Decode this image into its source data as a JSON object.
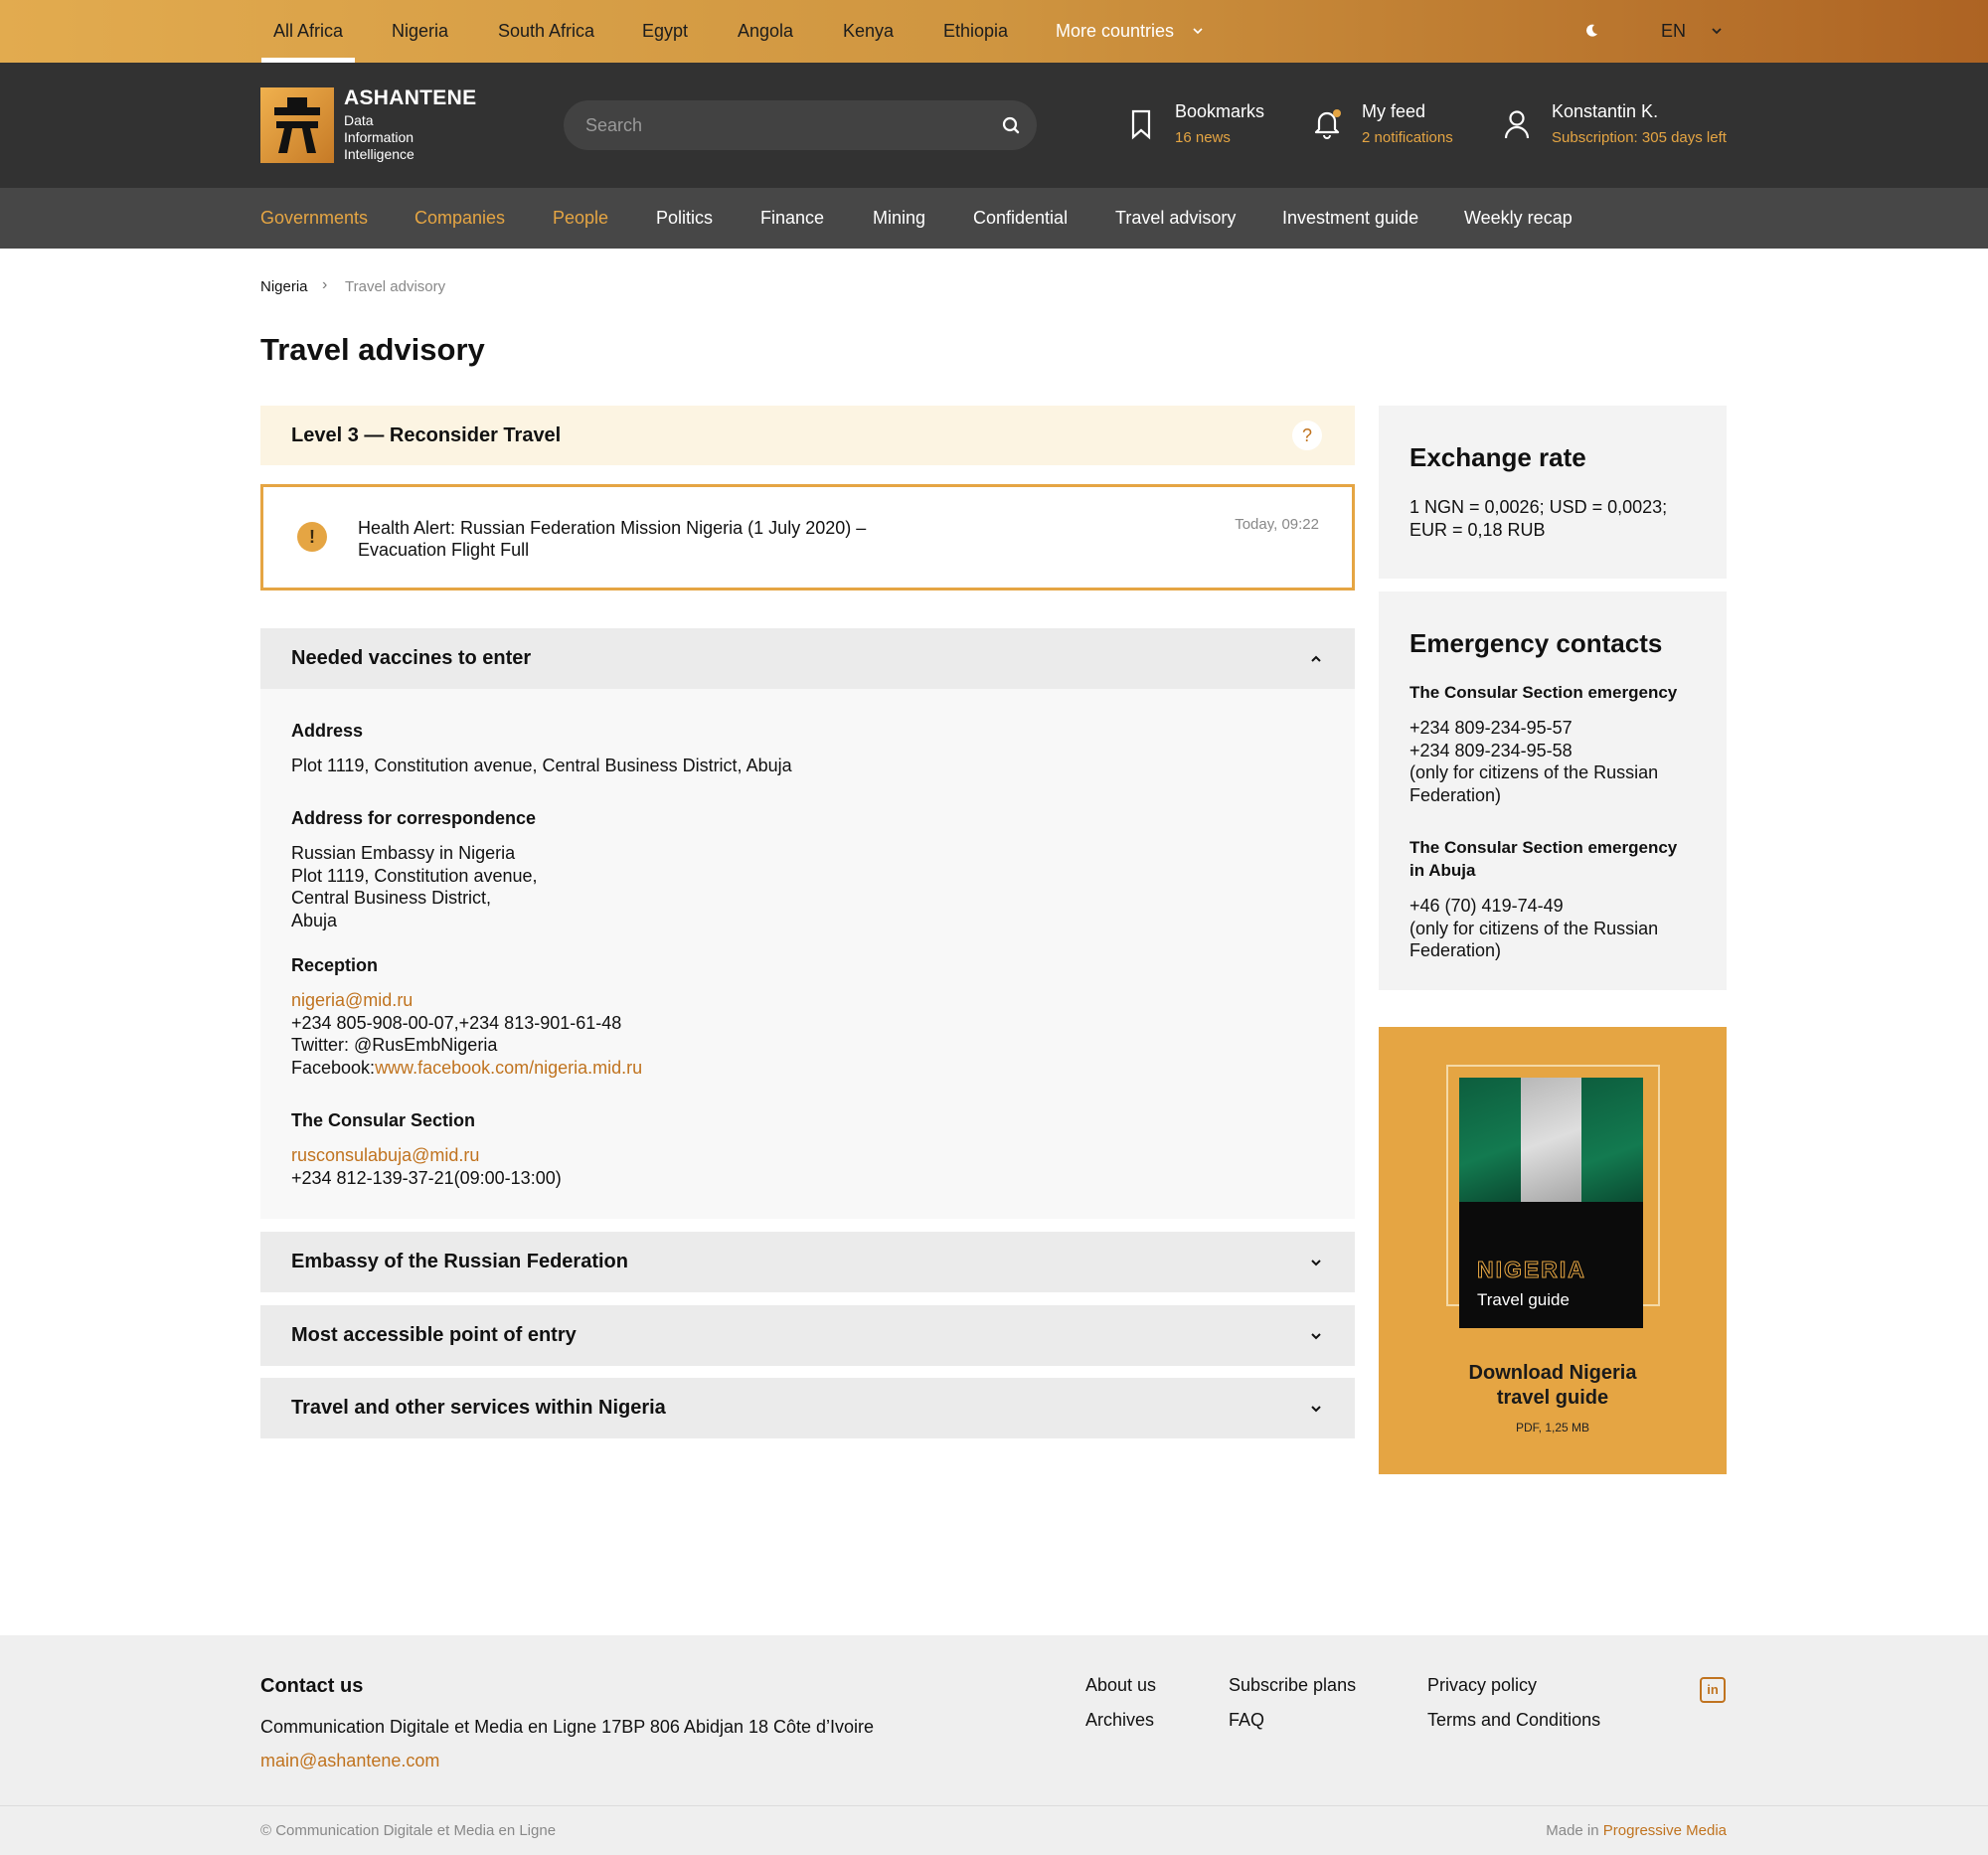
{
  "countries": {
    "items": [
      "All Africa",
      "Nigeria",
      "South Africa",
      "Egypt",
      "Angola",
      "Kenya",
      "Ethiopia"
    ],
    "more_label": "More countries",
    "language": "EN"
  },
  "header": {
    "brand_name": "ASHANTENE",
    "brand_tagline": [
      "Data",
      "Information",
      "Intelligence"
    ],
    "search_placeholder": "Search",
    "bookmarks": {
      "title": "Bookmarks",
      "sub": "16 news"
    },
    "feed": {
      "title": "My feed",
      "sub": "2 notifications"
    },
    "user": {
      "title": "Konstantin K.",
      "sub": "Subscription: 305 days left"
    }
  },
  "nav": {
    "items": [
      "Governments",
      "Companies",
      "People",
      "Politics",
      "Finance",
      "Mining",
      "Confidential",
      "Travel advisory",
      "Investment guide",
      "Weekly recap"
    ]
  },
  "breadcrumb": {
    "parent": "Nigeria",
    "current": "Travel advisory"
  },
  "page_title": "Travel advisory",
  "level": {
    "label": "Level 3 — Reconsider Travel",
    "help": "?"
  },
  "alert": {
    "icon": "!",
    "line1": "Health Alert: Russian Federation Mission Nigeria (1 July 2020) –",
    "line2": "Evacuation Flight Full",
    "time": "Today, 09:22"
  },
  "accordions": {
    "open_title": "Needed vaccines to enter",
    "embassy_title": "Embassy of the Russian Federation",
    "entry_title": "Most accessible point of entry",
    "services_title": "Travel and other services within Nigeria"
  },
  "details": {
    "address_label": "Address",
    "address": "Plot 1119, Constitution avenue, Central Business District, Abuja",
    "corr_label": "Address for correspondence",
    "corr_lines": [
      "Russian Embassy in Nigeria",
      "Plot 1119, Constitution avenue,",
      "Central Business District,",
      "Abuja"
    ],
    "reception_label": "Reception",
    "reception_email": "nigeria@mid.ru",
    "reception_phones": "+234 805-908-00-07,+234 813-901-61-48",
    "reception_twitter": "Twitter: @RusEmbNigeria",
    "reception_facebook_label": "Facebook:",
    "reception_facebook_url": "www.facebook.com/nigeria.mid.ru",
    "consular_label": "The Consular Section",
    "consular_email": "rusconsulabuja@mid.ru",
    "consular_phone": "+234 812-139-37-21(09:00-13:00)"
  },
  "exchange": {
    "title": "Exchange rate",
    "line1": "1 NGN = 0,0026; USD = 0,0023;",
    "line2": "EUR = 0,18 RUB"
  },
  "emergency": {
    "title": "Emergency contacts",
    "c1_title": "The Consular Section emergency",
    "c1_lines": [
      "+234 809-234-95-57",
      "+234 809-234-95-58",
      "(only for citizens of the Russian",
      "Federation)"
    ],
    "c2_title_lines": [
      "The Consular Section emergency",
      "in Abuja"
    ],
    "c2_lines": [
      "+46 (70) 419-74-49",
      "(only for citizens of the Russian",
      "Federation)"
    ]
  },
  "guide": {
    "cover_title": "NIGERIA",
    "cover_sub": "Travel guide",
    "download_lines": [
      "Download Nigeria",
      "travel guide"
    ],
    "meta": "PDF, 1,25 MB",
    "flag_colors": [
      "#0f6b47",
      "#c9c9c9",
      "#0f6b47"
    ]
  },
  "footer": {
    "contact_title": "Contact us",
    "address": "Communication Digitale et Media en Ligne 17BP 806 Abidjan 18 Côte d’Ivoire",
    "email": "main@ashantene.com",
    "links": [
      "About us",
      "Archives",
      "Subscribe plans",
      "FAQ",
      "Privacy policy",
      "Terms and Conditions"
    ],
    "social": "in",
    "copyright": "© Communication Digitale et Media en Ligne",
    "made_prefix": "Made in",
    "made_by": "Progressive Media"
  },
  "colors": {
    "accent": "#e5a543",
    "link": "#c0731f",
    "header_bg": "#323232",
    "nav_bg": "#474747"
  }
}
